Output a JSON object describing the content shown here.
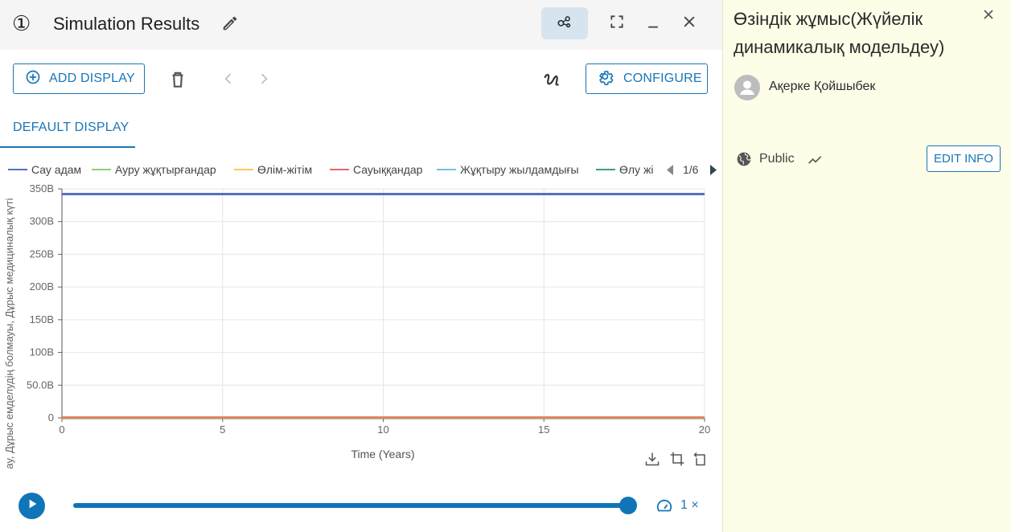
{
  "header": {
    "index_glyph": "①",
    "title": "Simulation Results"
  },
  "toolbar": {
    "add_display_label": "ADD DISPLAY",
    "configure_label": "CONFIGURE"
  },
  "tabs": [
    {
      "label": "DEFAULT DISPLAY",
      "active": true
    }
  ],
  "chart_data": {
    "type": "line",
    "title": "",
    "xlabel": "Time (Years)",
    "ylabel": "ау, Дұрыс емделудің болмауы, Дұрыс медициналық күті",
    "xlim": [
      0,
      20
    ],
    "ylim": [
      0,
      350
    ],
    "x_ticks": [
      "0",
      "5",
      "10",
      "15",
      "20"
    ],
    "y_ticks": [
      "0",
      "50.0B",
      "100B",
      "150B",
      "200B",
      "250B",
      "300B",
      "350B"
    ],
    "legend_page": "1/6",
    "legend_position": "top",
    "grid": true,
    "series": [
      {
        "name": "Сау адам",
        "color": "#5470c6",
        "x": [
          0,
          20
        ],
        "y": [
          342,
          342
        ]
      },
      {
        "name": "Ауру жұқтырғандар",
        "color": "#91cc75",
        "x": [
          0,
          20
        ],
        "y": [
          0,
          0
        ]
      },
      {
        "name": "Өлім-жітім",
        "color": "#fac858",
        "x": [
          0,
          20
        ],
        "y": [
          0,
          0
        ]
      },
      {
        "name": "Сауыққандар",
        "color": "#ee6666",
        "x": [
          0,
          20
        ],
        "y": [
          0,
          0
        ]
      },
      {
        "name": "Жұқтыру жылдамдығы",
        "color": "#73c0de",
        "x": [
          0,
          20
        ],
        "y": [
          0,
          0
        ]
      },
      {
        "name": "Өлу жі",
        "color": "#3ba272",
        "x": [
          0,
          20
        ],
        "y": [
          0,
          0
        ]
      }
    ]
  },
  "playback": {
    "speed_label": "1 ×",
    "progress": 1.0
  },
  "info_panel": {
    "title": "Өзіндік жұмыс(Жүйелік динамикалық модельдеу)",
    "author": "Ақерке Қойшыбек",
    "visibility": "Public",
    "edit_info_label": "EDIT INFO"
  },
  "colors": {
    "accent": "#1976b5",
    "panel_bg": "#fdfde8",
    "header_bg": "#f5f5f5"
  }
}
